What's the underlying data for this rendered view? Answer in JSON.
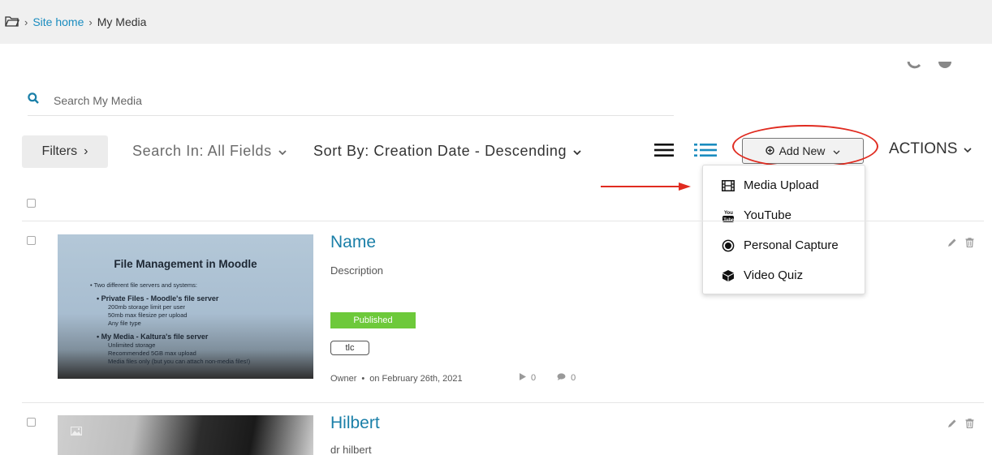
{
  "breadcrumb": {
    "home": "Site home",
    "current": "My Media"
  },
  "search": {
    "placeholder": "Search My Media"
  },
  "toolbar": {
    "filters_label": "Filters",
    "search_in_label": "Search In: All Fields",
    "sort_by_label": "Sort By: Creation Date - Descending",
    "add_new_label": "Add New",
    "actions_label": "ACTIONS"
  },
  "add_new_menu": [
    {
      "label": "Media Upload",
      "icon": "film-icon"
    },
    {
      "label": "YouTube",
      "icon": "youtube-icon"
    },
    {
      "label": "Personal Capture",
      "icon": "record-icon"
    },
    {
      "label": "Video Quiz",
      "icon": "cube-icon"
    }
  ],
  "entries": [
    {
      "name": "Name",
      "description": "Description",
      "status": "Published",
      "tag": "tlc",
      "owner": "Owner",
      "date": "on February 26th, 2021",
      "plays": "0",
      "comments": "0",
      "thumbnail": {
        "title": "File Management in Moodle",
        "lines": [
          "• Two different file servers and systems:",
          "• Private Files - Moodle's file server",
          "200mb storage limit per user",
          "50mb max filesize per upload",
          "Any file type",
          "• My Media - Kaltura's file server",
          "Unlimited storage",
          "Recommended 5GB max upload",
          "Media files only (but you can attach non-media files!)"
        ]
      }
    },
    {
      "name": "Hilbert",
      "description": "dr hilbert"
    }
  ],
  "colors": {
    "link": "#1a7fa8",
    "published": "#6dc93a",
    "highlight": "#e02b20"
  }
}
